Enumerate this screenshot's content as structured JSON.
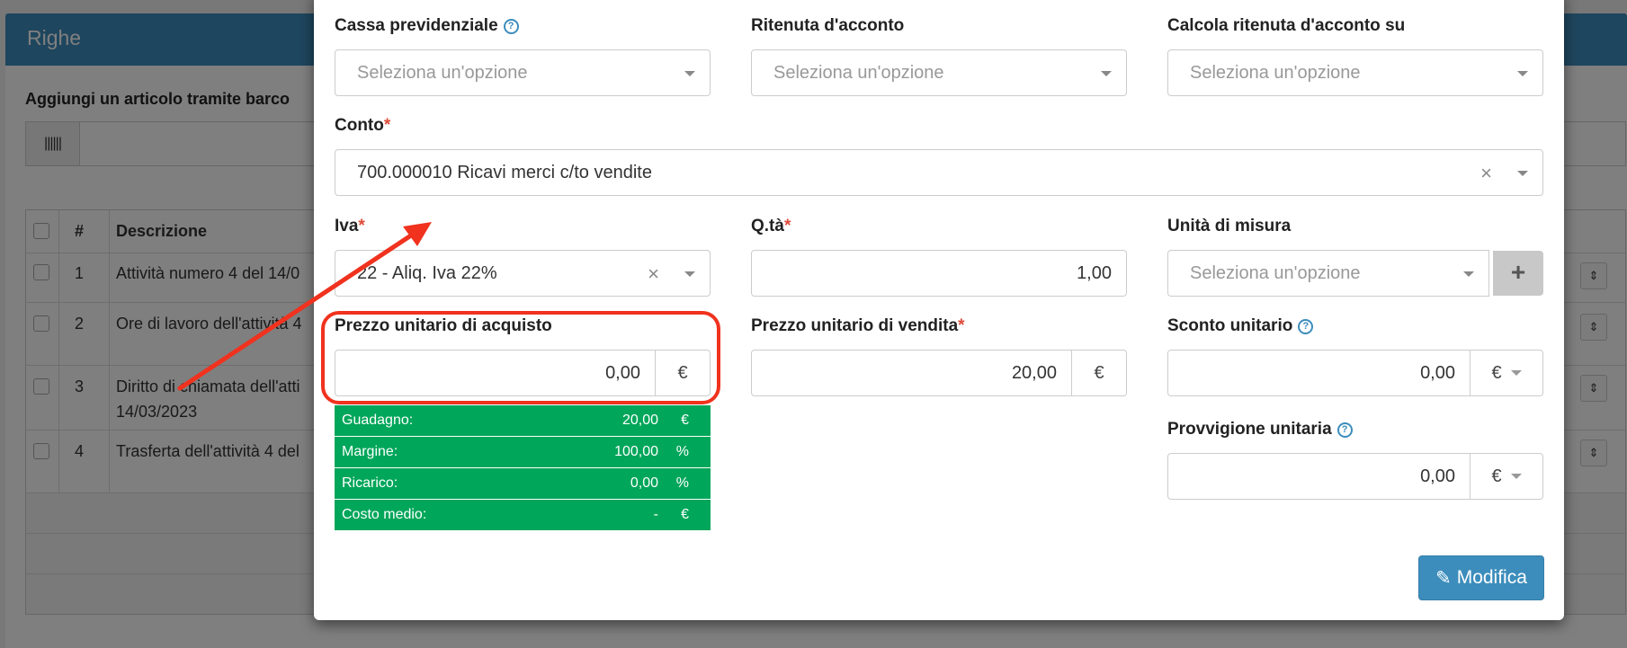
{
  "background": {
    "panel_title": "Righe",
    "barcode_label": "Aggiungi un articolo tramite barco",
    "barcode_icon": "barcode-icon",
    "table": {
      "headers": {
        "num": "#",
        "description": "Descrizione"
      },
      "rows": [
        {
          "num": "1",
          "description": "Attività numero 4 del 14/0"
        },
        {
          "num": "2",
          "description": "Ore di lavoro dell'attività 4"
        },
        {
          "num": "3",
          "description": "Diritto di chiamata dell'atti",
          "description2": "14/03/2023"
        },
        {
          "num": "4",
          "description": "Trasferta dell'attività 4 del"
        }
      ]
    }
  },
  "modal": {
    "cassa": {
      "label": "Cassa previdenziale",
      "placeholder": "Seleziona un'opzione"
    },
    "ritenuta": {
      "label": "Ritenuta d'acconto",
      "placeholder": "Seleziona un'opzione"
    },
    "calcola": {
      "label": "Calcola ritenuta d'acconto su",
      "placeholder": "Seleziona un'opzione"
    },
    "conto": {
      "label": "Conto",
      "required": "*",
      "value": "700.000010 Ricavi merci c/to vendite"
    },
    "iva": {
      "label": "Iva",
      "required": "*",
      "value": "22 - Aliq. Iva 22%"
    },
    "qta": {
      "label": "Q.tà",
      "required": "*",
      "value": "1,00"
    },
    "um": {
      "label": "Unità di misura",
      "placeholder": "Seleziona un'opzione",
      "add": "+"
    },
    "prezzo_acquisto": {
      "label": "Prezzo unitario di acquisto",
      "value": "0,00",
      "currency": "€"
    },
    "prezzo_vendita": {
      "label": "Prezzo unitario di vendita",
      "required": "*",
      "value": "20,00",
      "currency": "€"
    },
    "sconto": {
      "label": "Sconto unitario",
      "value": "0,00",
      "currency": "€"
    },
    "provvigione": {
      "label": "Provvigione unitaria",
      "value": "0,00",
      "currency": "€"
    },
    "stats": [
      {
        "label": "Guadagno:",
        "value": "20,00",
        "unit": "€"
      },
      {
        "label": "Margine:",
        "value": "100,00",
        "unit": "%"
      },
      {
        "label": "Ricarico:",
        "value": "0,00",
        "unit": "%"
      },
      {
        "label": "Costo medio:",
        "value": "-",
        "unit": "€"
      }
    ],
    "submit": {
      "label": "Modifica",
      "icon": "pencil-icon"
    },
    "help_icon": "?",
    "clear_icon": "×"
  },
  "colors": {
    "primary": "#3c8dbc",
    "success": "#00a65a",
    "annotation": "#f0321e",
    "required": "#dd4b39"
  }
}
